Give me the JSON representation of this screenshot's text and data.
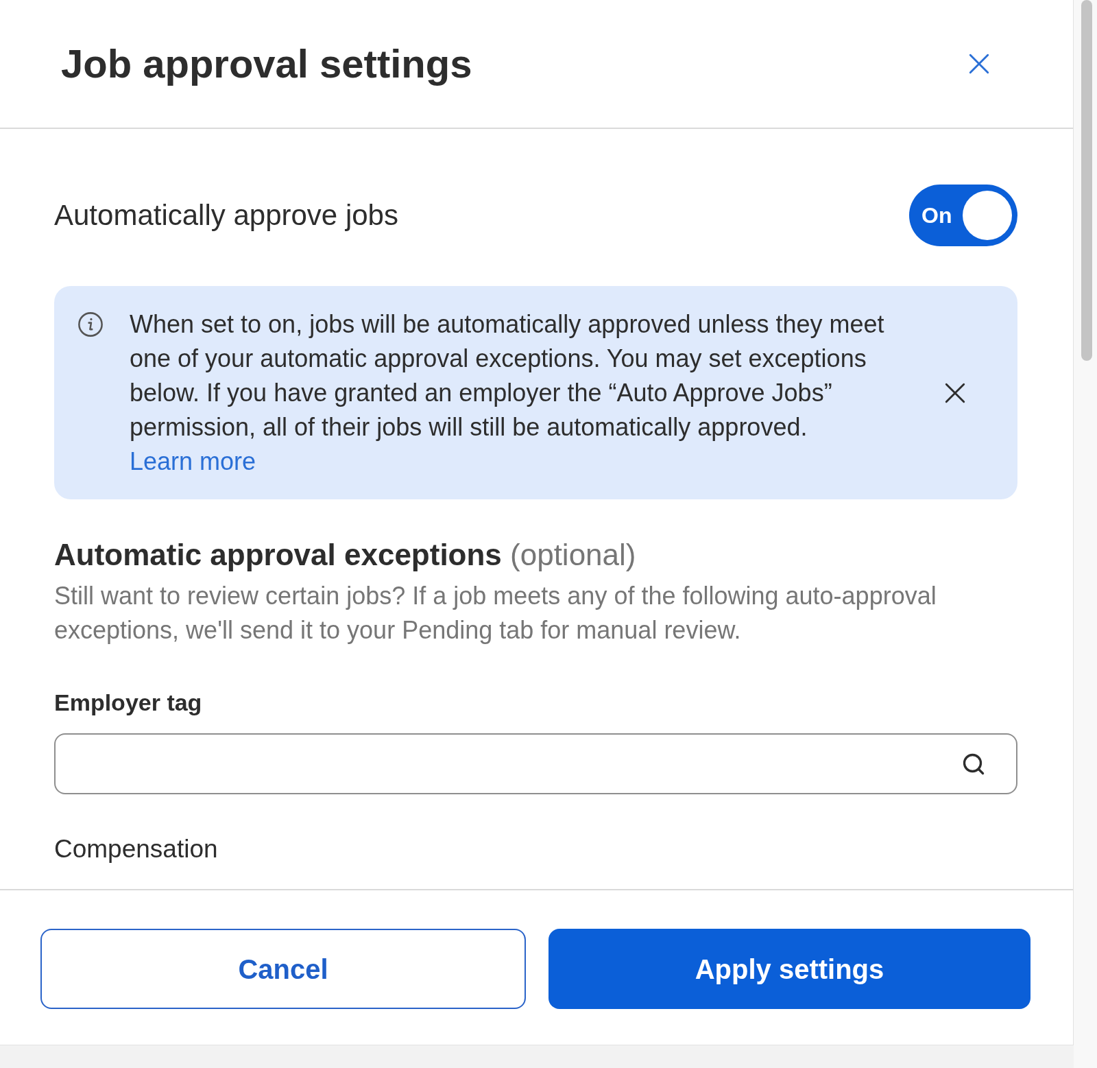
{
  "dialog": {
    "title": "Job approval settings"
  },
  "auto_approve": {
    "label": "Automatically approve jobs",
    "toggle": {
      "on": true,
      "label": "On"
    }
  },
  "info_banner": {
    "text": "When set to on, jobs will be automatically approved unless they meet one of your automatic approval exceptions. You may set exceptions below. If you have granted an employer the “Auto Approve Jobs” permission, all of their jobs will still be automatically approved.",
    "link": "Learn more"
  },
  "exceptions": {
    "heading": "**Automatic approval exceptions** (optional)",
    "description": "Still want to review certain jobs? If a job meets any of the following auto-approval exceptions, we'll send it to your Pending tab for manual review."
  },
  "fields": [
    {
      "kind": "search",
      "label": "Employer tag"
    },
    {
      "kind": "label",
      "label": "Compensation"
    }
  ],
  "buttons": [
    {
      "kind": "secondary",
      "label": "Cancel"
    },
    {
      "kind": "primary",
      "label": "Apply settings"
    }
  ]
}
